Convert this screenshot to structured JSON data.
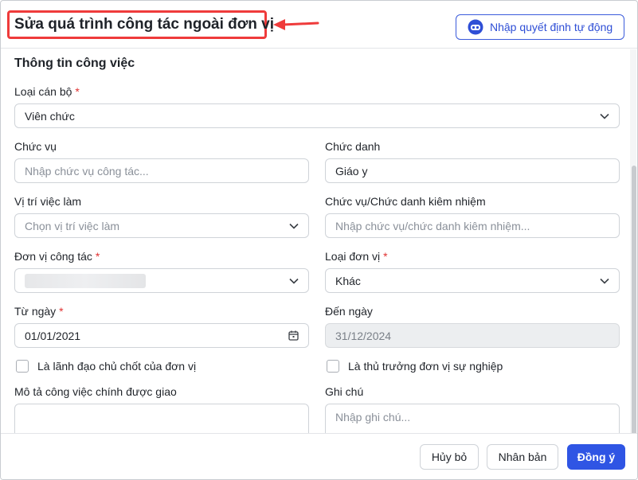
{
  "header": {
    "title": "Sửa quá trình công tác ngoài đơn vị",
    "auto_button": "Nhập quyết định tự động"
  },
  "section_title": "Thông tin công việc",
  "fields": {
    "loai_can_bo": {
      "label": "Loại cán bộ",
      "required": "*",
      "value": "Viên chức"
    },
    "chuc_vu": {
      "label": "Chức vụ",
      "placeholder": "Nhập chức vụ công tác..."
    },
    "chuc_danh": {
      "label": "Chức danh",
      "value": "Giáo y"
    },
    "vi_tri": {
      "label": "Vị trí việc làm",
      "placeholder": "Chọn vị trí việc làm"
    },
    "kiem_nhiem": {
      "label": "Chức vụ/Chức danh kiêm nhiệm",
      "placeholder": "Nhập chức vụ/chức danh kiêm nhiệm..."
    },
    "don_vi": {
      "label": "Đơn vị công tác",
      "required": "*"
    },
    "loai_don_vi": {
      "label": "Loại đơn vị",
      "required": "*",
      "value": "Khác"
    },
    "tu_ngay": {
      "label": "Từ ngày",
      "required": "*",
      "value": "01/01/2021"
    },
    "den_ngay": {
      "label": "Đến ngày",
      "value": "31/12/2024"
    },
    "lanh_dao": {
      "label": "Là lãnh đạo chủ chốt của đơn vị"
    },
    "thu_truong": {
      "label": "Là thủ trưởng đơn vị sự nghiệp"
    },
    "mo_ta": {
      "label": "Mô tả công việc chính được giao"
    },
    "ghi_chu": {
      "label": "Ghi chú",
      "placeholder": "Nhập ghi chú..."
    }
  },
  "footer": {
    "cancel": "Hủy bỏ",
    "duplicate": "Nhân bản",
    "confirm": "Đồng ý"
  },
  "colors": {
    "primary": "#2f55e4",
    "highlight": "#ef3b3b",
    "required": "#e03131"
  }
}
